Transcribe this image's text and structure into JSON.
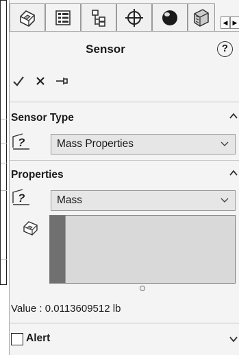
{
  "panel": {
    "title": "Sensor",
    "help_glyph": "?",
    "tabs": [
      {
        "icon": "feature-manager-icon"
      },
      {
        "icon": "property-manager-icon",
        "active": true
      },
      {
        "icon": "configuration-manager-icon"
      },
      {
        "icon": "dimxpert-icon"
      },
      {
        "icon": "display-manager-icon"
      },
      {
        "icon": "cam-manager-icon"
      }
    ],
    "tab_scroll": {
      "left": "◀",
      "right": "▶"
    },
    "actions": {
      "ok": "✓",
      "cancel": "✕",
      "pin": "pin-icon"
    }
  },
  "sensor_type": {
    "header": "Sensor Type",
    "selected": "Mass Properties"
  },
  "properties": {
    "header": "Properties",
    "selected": "Mass",
    "value_text": "Value : 0.0113609512 lb"
  },
  "alert": {
    "label": "Alert",
    "checked": false
  }
}
